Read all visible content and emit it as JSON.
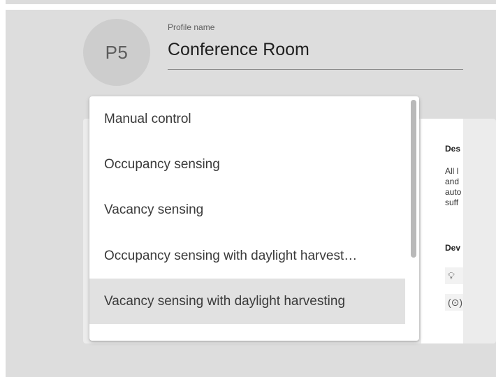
{
  "profile": {
    "avatar_text": "P5",
    "name_label": "Profile name",
    "name_value": "Conference Room"
  },
  "menu": {
    "items": [
      {
        "label": "Manual control",
        "selected": false
      },
      {
        "label": "Occupancy sensing",
        "selected": false
      },
      {
        "label": "Vacancy sensing",
        "selected": false
      },
      {
        "label": "Occupancy sensing with daylight harvest…",
        "selected": false
      },
      {
        "label": "Vacancy sensing with daylight harvesting",
        "selected": true
      }
    ]
  },
  "details": {
    "description_heading": "Des",
    "description_lines": [
      "All l",
      "and",
      "auto",
      "suff"
    ],
    "devices_heading": "Dev",
    "device_icons": [
      "lightbulb-icon",
      "sensor-icon"
    ]
  }
}
